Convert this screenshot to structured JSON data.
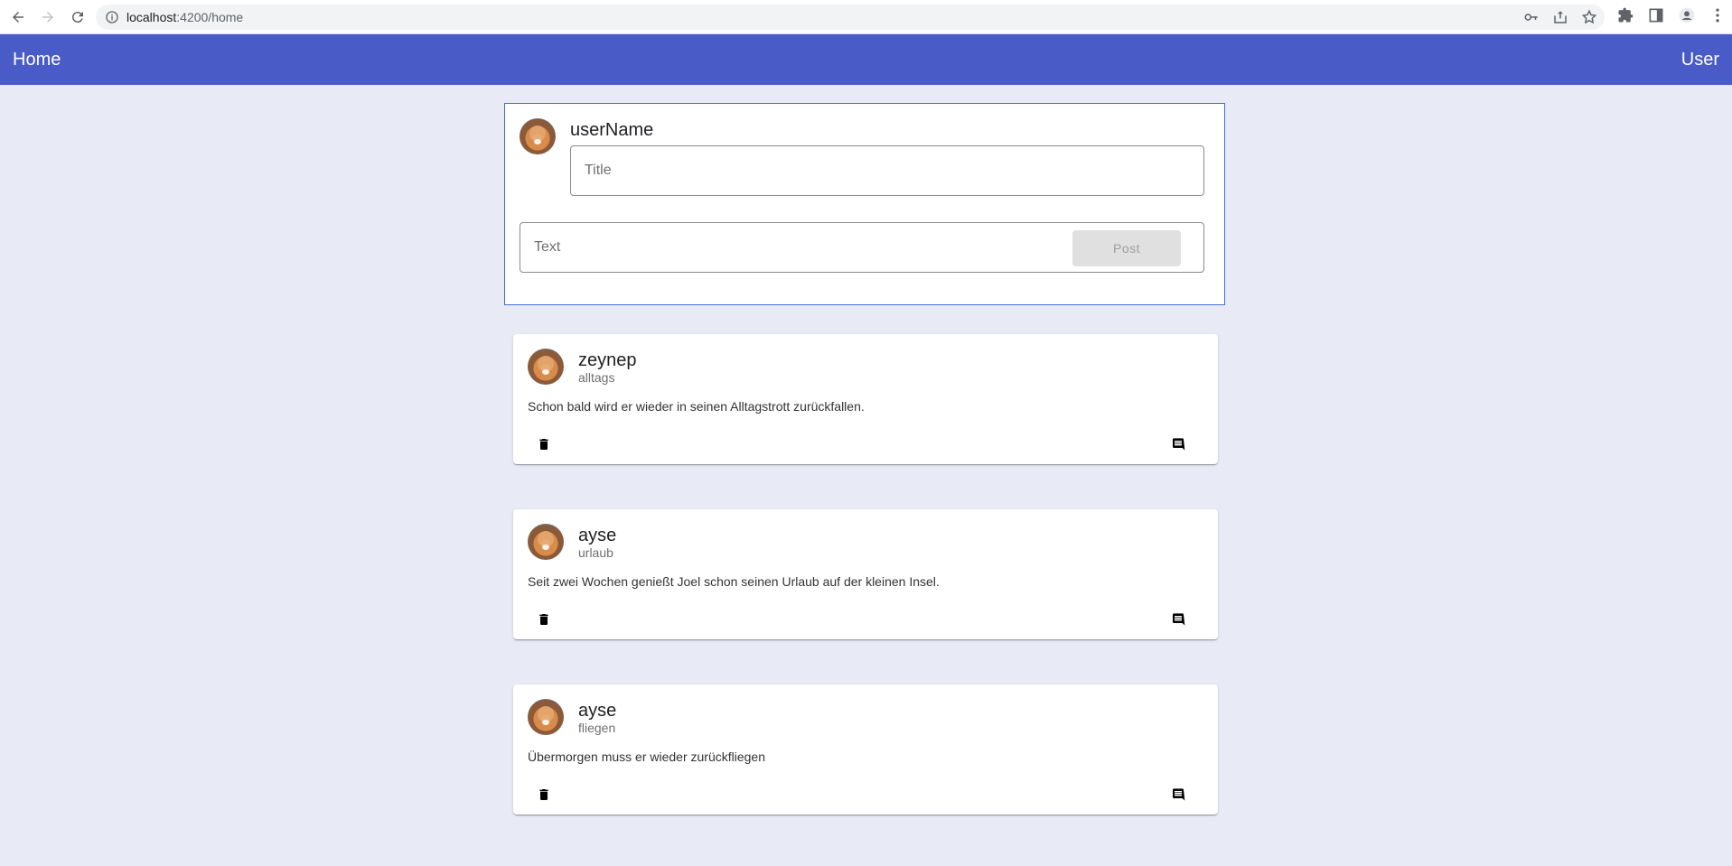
{
  "browser": {
    "url_host": "localhost",
    "url_path": ":4200/home"
  },
  "toolbar": {
    "home_label": "Home",
    "user_label": "User"
  },
  "compose": {
    "username": "userName",
    "title_placeholder": "Title",
    "text_placeholder": "Text",
    "post_label": "Post"
  },
  "posts": [
    {
      "author": "zeynep",
      "subtitle": "alltags",
      "text": "Schon bald wird er wieder in seinen Alltagstrott zurückfallen."
    },
    {
      "author": "ayse",
      "subtitle": "urlaub",
      "text": "Seit zwei Wochen genießt Joel schon seinen Urlaub auf der kleinen Insel."
    },
    {
      "author": "ayse",
      "subtitle": "fliegen",
      "text": "Übermorgen muss er wieder zurückfliegen"
    }
  ],
  "icons": {
    "delete": "delete-icon",
    "comment": "comment-icon",
    "avatar": "shiba-avatar"
  },
  "colors": {
    "toolbar": "#485bc7",
    "background": "#e8eaf6",
    "compose_border": "#3f6fd1"
  }
}
